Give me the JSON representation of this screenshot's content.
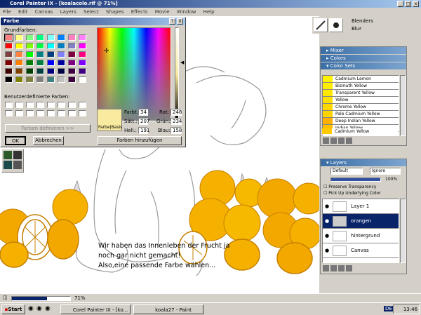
{
  "app": {
    "title": "Corel Painter IX - [koalacolo.rif @ 71%]",
    "menu": [
      "File",
      "Edit",
      "Canvas",
      "Layers",
      "Select",
      "Shapes",
      "Effects",
      "Movie",
      "Window",
      "Help"
    ]
  },
  "brush": {
    "category": "Blenders",
    "variant": "Blur"
  },
  "color_dialog": {
    "title": "Farbe",
    "help_glyph": "?",
    "close_glyph": "X",
    "basic_label": "Grundfarben:",
    "custom_label": "Benutzerdefinierte Farben:",
    "define_button": "Farben definieren >>",
    "ok_button": "OK",
    "cancel_button": "Abbrechen",
    "add_button": "Farben hinzufügen",
    "preview_label": "Farbe|Basis",
    "fields": {
      "farbt_label": "Farbt.:",
      "farbt_value": "34",
      "saett_label": "Sätt.:",
      "saett_value": "207",
      "hell_label": "Hell.:",
      "hell_value": "191",
      "rot_label": "Rot:",
      "rot_value": "248",
      "gruen_label": "Grün:",
      "gruen_value": "234",
      "blau_label": "Blau:",
      "blau_value": "158"
    },
    "basic_colors": [
      "#ff8080",
      "#ffff80",
      "#80ff80",
      "#00ff80",
      "#80ffff",
      "#0080ff",
      "#ff80c0",
      "#ff80ff",
      "#ff0000",
      "#ffff00",
      "#80ff00",
      "#00ff40",
      "#00ffff",
      "#0080c0",
      "#8080c0",
      "#ff00ff",
      "#804040",
      "#ff8040",
      "#00ff00",
      "#008080",
      "#004080",
      "#8080ff",
      "#800040",
      "#ff0080",
      "#800000",
      "#ff8000",
      "#008000",
      "#008040",
      "#0000ff",
      "#0000a0",
      "#800080",
      "#8000ff",
      "#400000",
      "#804000",
      "#004000",
      "#004040",
      "#000080",
      "#000040",
      "#400040",
      "#400080",
      "#000000",
      "#808000",
      "#808040",
      "#808080",
      "#408080",
      "#c0c0c0",
      "#400040",
      "#ffffff"
    ],
    "custom_colors": [
      "#ffffff",
      "#ffffff",
      "#ffffff",
      "#ffffff",
      "#ffffff",
      "#ffffff",
      "#ffffff",
      "#ffffff",
      "#ffffff",
      "#ffffff",
      "#ffffff",
      "#ffffff",
      "#ffffff",
      "#ffffff",
      "#ffffff",
      "#ffffff"
    ],
    "selected_color": "#f8ea9e"
  },
  "panels": {
    "mixer": "Mixer",
    "colors": "Colors",
    "color_sets": "Color Sets",
    "color_set_items": [
      {
        "name": "Cadmium Lemon",
        "color": "#fff200"
      },
      {
        "name": "Bismuth Yellow",
        "color": "#ffee00"
      },
      {
        "name": "Transparent Yellow",
        "color": "#ffe800"
      },
      {
        "name": "Yellow",
        "color": "#ffe000"
      },
      {
        "name": "Chrome Yellow",
        "color": "#ffd800"
      },
      {
        "name": "Pale Cadmium Yellow",
        "color": "#ffd400"
      },
      {
        "name": "Deep Indian Yellow",
        "color": "#ffb000"
      },
      {
        "name": "Indian Yellow",
        "color": "#ffc000"
      },
      {
        "name": "Cadmium Yellow",
        "color": "#ffc800"
      }
    ],
    "layers": {
      "title": "Layers",
      "composite_method": "Default",
      "depth": "Ignore",
      "opacity": "100%",
      "preserve_transparency": "Preserve Transparency",
      "pick_up_color": "Pick Up Underlying Color",
      "items": [
        {
          "name": "Layer 1",
          "selected": false
        },
        {
          "name": "orangen",
          "selected": true
        },
        {
          "name": "hintergrund",
          "selected": false
        },
        {
          "name": "Canvas",
          "selected": false
        }
      ]
    }
  },
  "canvas": {
    "zoom": "71%",
    "caption_lines": [
      "Wir haben das Innenleben der Frucht ja",
      "noch gar nicht gemacht!",
      "Also,eine passende Farbe wählen..."
    ]
  },
  "taskbar": {
    "start": "Start",
    "tasks": [
      "Corel Painter IX - [ko...",
      "koala27 - Paint"
    ],
    "lang": "DE",
    "time": "13:46"
  }
}
